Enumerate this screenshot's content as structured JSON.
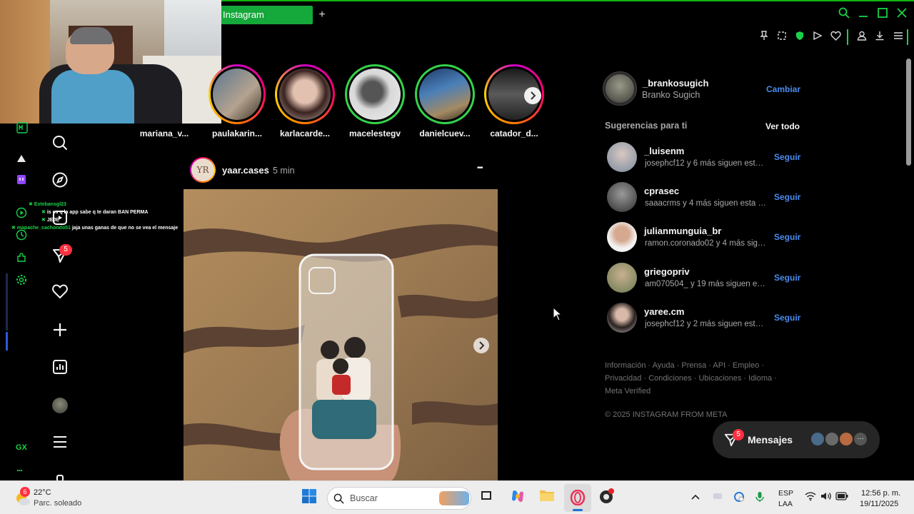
{
  "browser": {
    "tab_title": "Instagram",
    "new_tab": "+",
    "window_controls": [
      "search-icon",
      "minimize-icon",
      "maximize-icon",
      "close-icon"
    ],
    "toolbar_icons": [
      "pin-icon",
      "snapshot-icon",
      "shield-icon",
      "send-icon",
      "heart-icon",
      "profile-icon",
      "download-icon",
      "menu-icon"
    ],
    "accent_color": "#19d24a"
  },
  "gx_sidebar": {
    "icons": [
      "gx-menu-icon",
      "arrow-icon",
      "twitch-icon",
      "player-icon",
      "history-icon",
      "extensions-icon",
      "settings-icon"
    ],
    "bottom_label": "GX",
    "more": "..."
  },
  "chat_overlay": [
    {
      "user": "Estebansgl23",
      "message": ""
    },
    {
      "user": "",
      "message": "is es q la app sabe q te daran BAN PERMA"
    },
    {
      "user": "",
      "message": "JEJE"
    },
    {
      "user": "mapache_cachondo51",
      "message": "jaja unas ganas de que no se vea el mensaje"
    }
  ],
  "ig_nav": {
    "icons": [
      "search-icon",
      "explore-icon",
      "reels-icon",
      "messages-icon",
      "notifications-icon",
      "create-icon",
      "dashboard-icon",
      "profile-icon",
      "more-icon"
    ],
    "messages_badge": "5"
  },
  "stories": [
    {
      "username": "mariana_v..."
    },
    {
      "username": "paulakarin..."
    },
    {
      "username": "karlacarde..."
    },
    {
      "username": "macelestegv"
    },
    {
      "username": "danielcuev..."
    },
    {
      "username": "catador_d..."
    }
  ],
  "post": {
    "avatar_initials": "YR",
    "username": "yaar.cases",
    "separator": "•",
    "time": "5 min",
    "more": "•••",
    "next_icon": "chevron-right-icon"
  },
  "account": {
    "username": "_brankosugich",
    "full_name": "Branko Sugich",
    "switch_label": "Cambiar"
  },
  "suggestions": {
    "title": "Sugerencias para ti",
    "see_all": "Ver todo",
    "follow_label": "Seguir",
    "items": [
      {
        "username": "_luisenm",
        "subtitle": "josephcf12 y 6 más siguen esta ..."
      },
      {
        "username": "cprasec",
        "subtitle": "saaacrms y 4 más siguen esta cu..."
      },
      {
        "username": "julianmunguia_br",
        "subtitle": "ramon.coronado02 y 4 más sigu..."
      },
      {
        "username": "griegopriv",
        "subtitle": "am070504_ y 19 más siguen est..."
      },
      {
        "username": "yaree.cm",
        "subtitle": "josephcf12 y 2 más siguen esta ..."
      }
    ]
  },
  "footer": {
    "line1": "Información · Ayuda · Prensa · API · Empleo ·",
    "line2": "Privacidad · Condiciones · Ubicaciones · Idioma ·",
    "line3": "Meta Verified",
    "copyright": "© 2025 INSTAGRAM FROM META"
  },
  "messages_pill": {
    "label": "Mensajes",
    "badge": "5",
    "more": "···"
  },
  "taskbar": {
    "weather_temp": "22°C",
    "weather_desc": "Parc. soleado",
    "weather_badge": "6",
    "search_placeholder": "Buscar",
    "language_top": "ESP",
    "language_bottom": "LAA",
    "time": "12:56 p. m.",
    "date": "19/11/2025"
  }
}
